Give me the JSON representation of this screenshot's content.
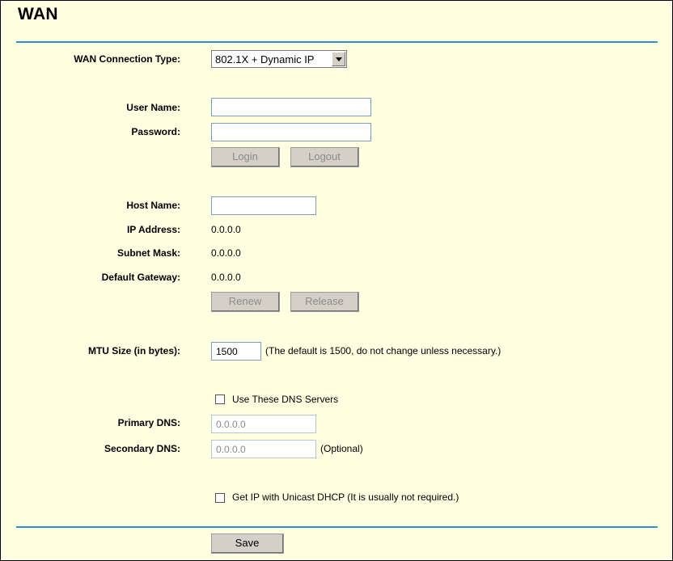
{
  "page": {
    "title": "WAN"
  },
  "colors": {
    "background": "#ffffe1",
    "rule": "#2b8ed8",
    "button_face": "#d4d0c8"
  },
  "wan_type": {
    "label": "WAN Connection Type:",
    "selected": "802.1X + Dynamic IP"
  },
  "auth": {
    "username_label": "User Name:",
    "username_value": "",
    "password_label": "Password:",
    "password_value": "",
    "login_button": "Login",
    "logout_button": "Logout"
  },
  "dhcp": {
    "host_name_label": "Host Name:",
    "host_name_value": "",
    "ip_label": "IP Address:",
    "ip_value": "0.0.0.0",
    "mask_label": "Subnet Mask:",
    "mask_value": "0.0.0.0",
    "gateway_label": "Default Gateway:",
    "gateway_value": "0.0.0.0",
    "renew_button": "Renew",
    "release_button": "Release"
  },
  "mtu": {
    "label": "MTU Size (in bytes):",
    "value": "1500",
    "hint": "(The default is 1500, do not change unless necessary.)"
  },
  "dns": {
    "use_dns_label": "Use These DNS Servers",
    "use_dns_checked": false,
    "primary_label": "Primary DNS:",
    "primary_value": "0.0.0.0",
    "secondary_label": "Secondary DNS:",
    "secondary_value": "0.0.0.0",
    "secondary_hint": "(Optional)"
  },
  "unicast": {
    "label": "Get IP with Unicast DHCP (It is usually not required.)",
    "checked": false
  },
  "footer": {
    "save_button": "Save"
  }
}
